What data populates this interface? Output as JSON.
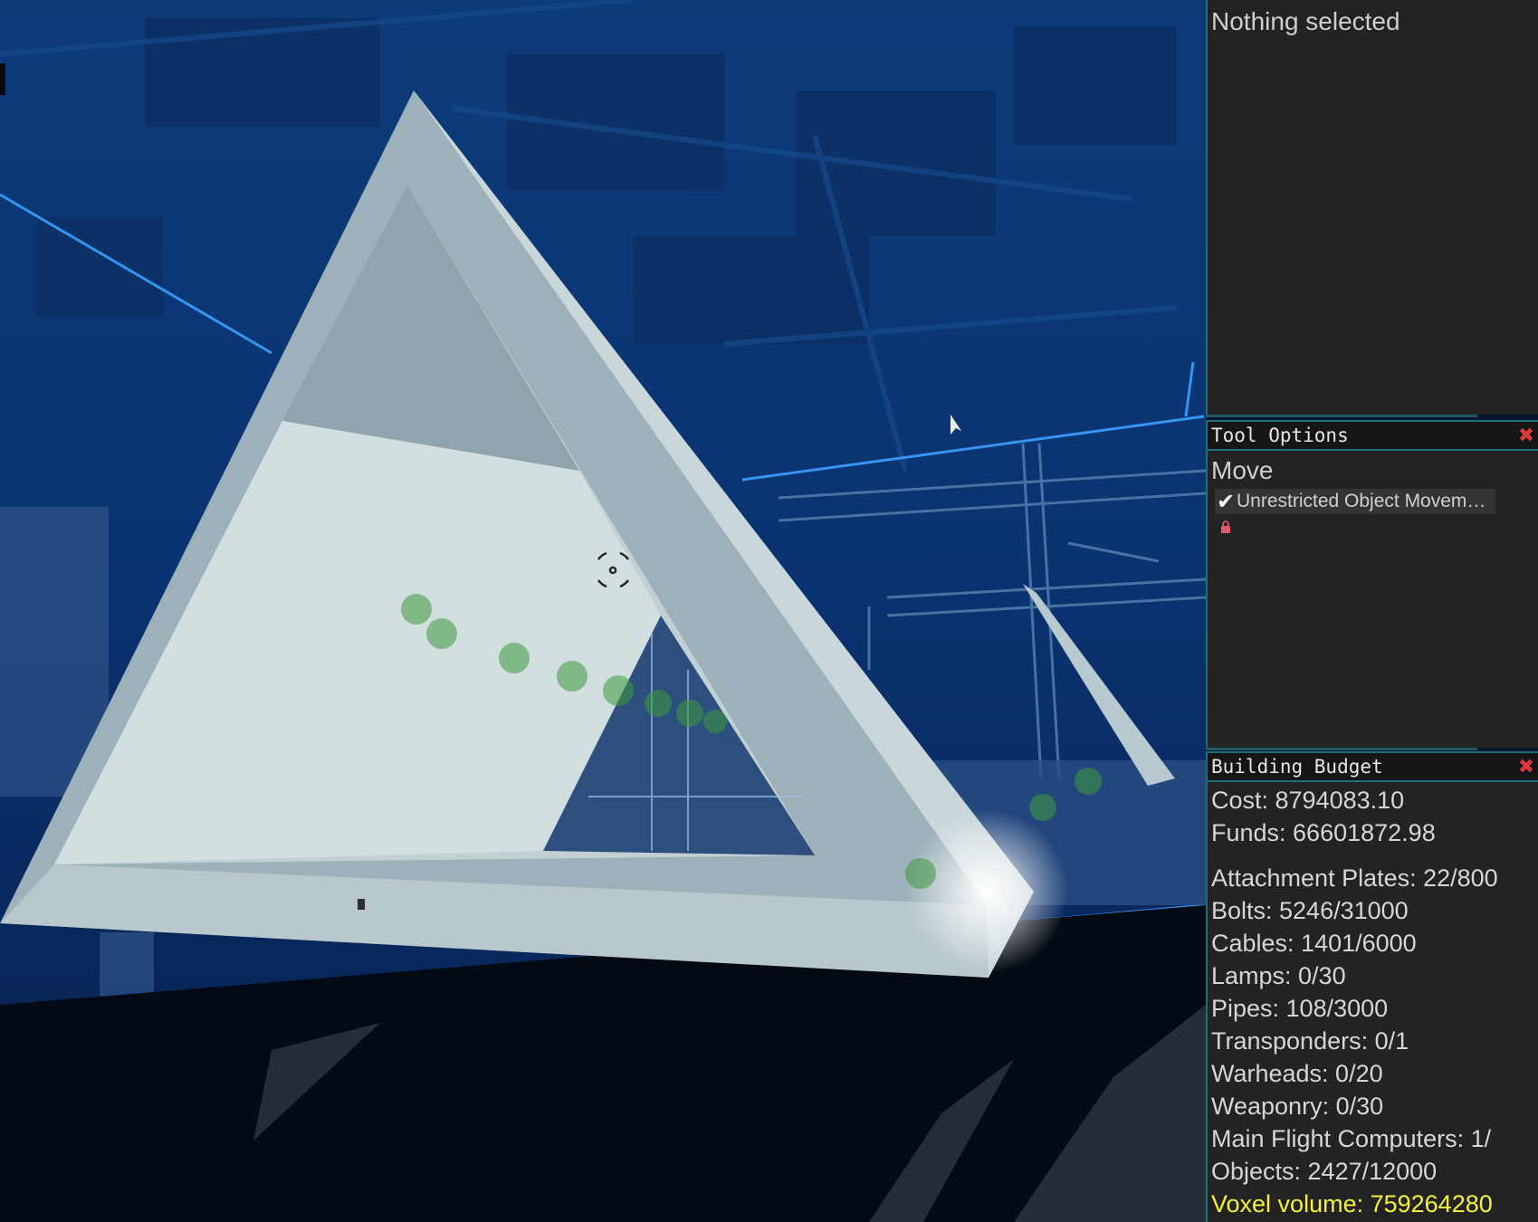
{
  "selection": {
    "status": "Nothing selected"
  },
  "tool_options": {
    "title": "Tool Options",
    "close_icon": "close-icon",
    "tool_name": "Move",
    "option_label": "Unrestricted Object Movem…",
    "option_checked": true,
    "lock_icon": "lock-icon"
  },
  "budget": {
    "title": "Building Budget",
    "close_icon": "close-icon",
    "cost": "Cost: 8794083.10",
    "funds": "Funds: 66601872.98",
    "attachment_plates": "Attachment Plates: 22/800",
    "bolts": "Bolts: 5246/31000",
    "cables": "Cables: 1401/6000",
    "lamps": "Lamps: 0/30",
    "pipes": "Pipes: 108/3000",
    "transponders": "Transponders: 0/1",
    "warheads": "Warheads: 0/20",
    "weaponry": "Weaponry: 0/30",
    "main_flight_computers": "Main Flight Computers: 1/",
    "objects": "Objects: 2427/12000",
    "voxel_volume": "Voxel volume: 759264280"
  },
  "colors": {
    "panel_bg": "#232323",
    "header_bg": "#151515",
    "accent": "#1e6f7a",
    "close": "#d93b3b",
    "voxel_highlight": "#f5f03a",
    "scene_blue": "#0a3a78"
  }
}
